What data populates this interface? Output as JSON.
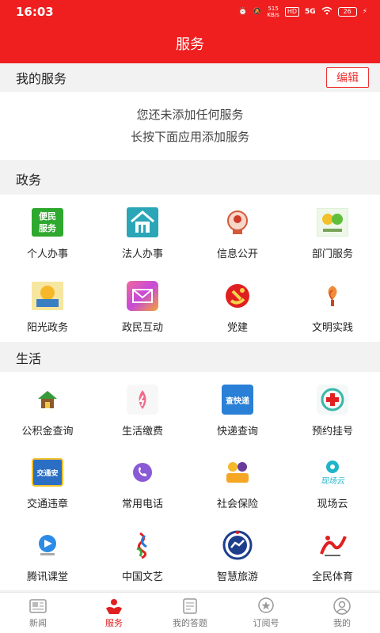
{
  "status": {
    "time": "16:03",
    "net_speed": "515\nKB/s",
    "hd": "HD",
    "signal": "5G",
    "battery": "26"
  },
  "title": "服务",
  "my_services": {
    "header": "我的服务",
    "edit": "编辑",
    "empty_line1": "您还未添加任何服务",
    "empty_line2": "长按下面应用添加服务"
  },
  "gov": {
    "header": "政务",
    "items": [
      {
        "label": "个人办事",
        "icon": "citizen-service-icon"
      },
      {
        "label": "法人办事",
        "icon": "legal-entity-icon"
      },
      {
        "label": "信息公开",
        "icon": "info-disclosure-icon"
      },
      {
        "label": "部门服务",
        "icon": "department-service-icon"
      },
      {
        "label": "阳光政务",
        "icon": "sunshine-gov-icon"
      },
      {
        "label": "政民互动",
        "icon": "mail-interaction-icon"
      },
      {
        "label": "党建",
        "icon": "party-building-icon"
      },
      {
        "label": "文明实践",
        "icon": "civilization-practice-icon"
      }
    ]
  },
  "life": {
    "header": "生活",
    "items": [
      {
        "label": "公积金查询",
        "icon": "housing-fund-icon"
      },
      {
        "label": "生活缴费",
        "icon": "utility-payment-icon"
      },
      {
        "label": "快递查询",
        "icon": "express-query-icon"
      },
      {
        "label": "预约挂号",
        "icon": "medical-appointment-icon"
      },
      {
        "label": "交通违章",
        "icon": "traffic-violation-icon"
      },
      {
        "label": "常用电话",
        "icon": "phone-icon"
      },
      {
        "label": "社会保险",
        "icon": "social-insurance-icon"
      },
      {
        "label": "现场云",
        "icon": "live-cloud-icon"
      },
      {
        "label": "腾讯课堂",
        "icon": "tencent-classroom-icon"
      },
      {
        "label": "中国文艺",
        "icon": "china-arts-icon"
      },
      {
        "label": "智慧旅游",
        "icon": "smart-tourism-icon"
      },
      {
        "label": "全民体育",
        "icon": "national-sports-icon"
      }
    ]
  },
  "icon_text": {
    "citizen": "便民\n服务",
    "express": "查快递",
    "traffic": "交通安",
    "live": "现场云"
  },
  "tabs": [
    {
      "label": "新闻",
      "icon": "news-icon"
    },
    {
      "label": "服务",
      "icon": "service-icon",
      "active": true
    },
    {
      "label": "我的答题",
      "icon": "quiz-icon"
    },
    {
      "label": "订阅号",
      "icon": "subscription-icon"
    },
    {
      "label": "我的",
      "icon": "profile-icon"
    }
  ],
  "colors": {
    "accent": "#ef1f1f",
    "active_tab": "#e02020"
  }
}
